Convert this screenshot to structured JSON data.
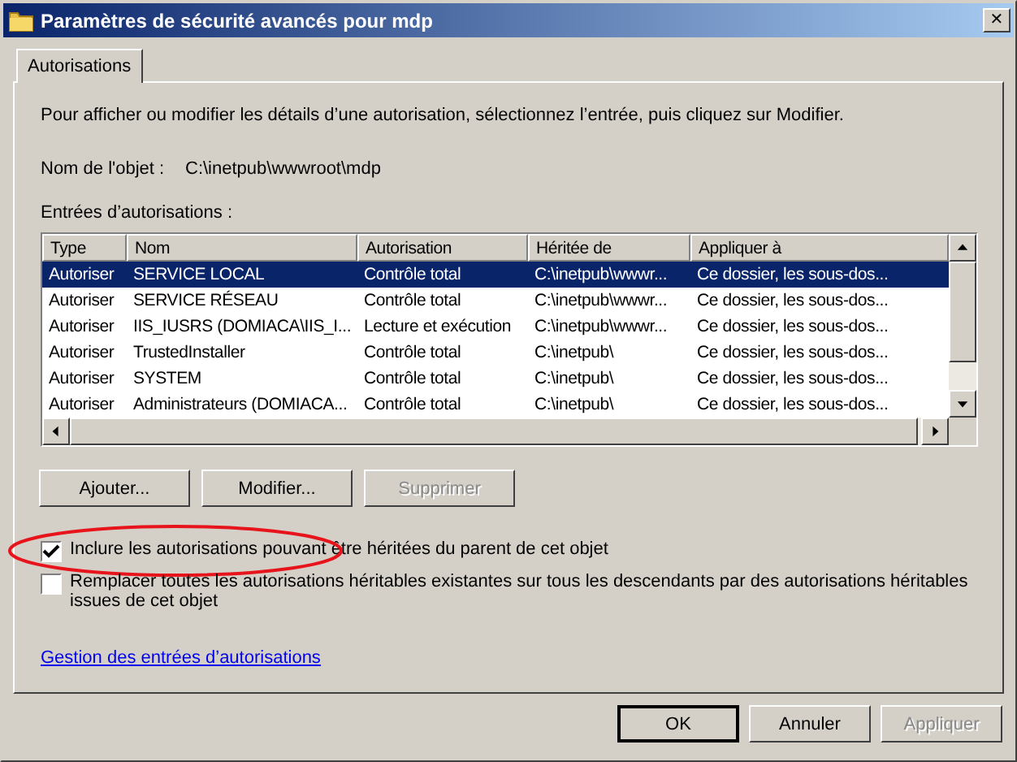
{
  "window": {
    "title": "Paramètres de sécurité avancés pour mdp",
    "close": "✕"
  },
  "tabs": [
    {
      "label": "Autorisations",
      "selected": true
    }
  ],
  "intro": "Pour afficher ou modifier les détails d’une autorisation, sélectionnez l’entrée, puis cliquez sur Modifier.",
  "object_name": {
    "label": "Nom de l'objet :",
    "value": "C:\\inetpub\\wwwroot\\mdp"
  },
  "entries_label": "Entrées d’autorisations :",
  "table": {
    "columns": [
      "Type",
      "Nom",
      "Autorisation",
      "Héritée de",
      "Appliquer à"
    ],
    "rows": [
      {
        "cells": [
          "Autoriser",
          "SERVICE LOCAL",
          "Contrôle total",
          "C:\\inetpub\\wwwr...",
          "Ce dossier, les sous-dos..."
        ],
        "selected": true
      },
      {
        "cells": [
          "Autoriser",
          "SERVICE RÉSEAU",
          "Contrôle total",
          "C:\\inetpub\\wwwr...",
          "Ce dossier, les sous-dos..."
        ],
        "selected": false
      },
      {
        "cells": [
          "Autoriser",
          "IIS_IUSRS (DOMIACA\\IIS_I...",
          "Lecture et exécution",
          "C:\\inetpub\\wwwr...",
          "Ce dossier, les sous-dos..."
        ],
        "selected": false
      },
      {
        "cells": [
          "Autoriser",
          "TrustedInstaller",
          "Contrôle total",
          "C:\\inetpub\\",
          "Ce dossier, les sous-dos..."
        ],
        "selected": false
      },
      {
        "cells": [
          "Autoriser",
          "SYSTEM",
          "Contrôle total",
          "C:\\inetpub\\",
          "Ce dossier, les sous-dos..."
        ],
        "selected": false
      },
      {
        "cells": [
          "Autoriser",
          "Administrateurs (DOMIACA...",
          "Contrôle total",
          "C:\\inetpub\\",
          "Ce dossier, les sous-dos..."
        ],
        "selected": false
      }
    ]
  },
  "entry_buttons": [
    {
      "label": "Ajouter...",
      "disabled": false
    },
    {
      "label": "Modifier...",
      "disabled": false
    },
    {
      "label": "Supprimer",
      "disabled": true
    }
  ],
  "checkboxes": [
    {
      "label": "Inclure les autorisations pouvant être héritées du parent de cet objet",
      "checked": true,
      "highlighted": true
    },
    {
      "label": "Remplacer toutes les autorisations héritables existantes sur tous les descendants par des autorisations héritables issues de cet objet",
      "checked": false,
      "highlighted": false
    }
  ],
  "link": "Gestion des entrées d’autorisations",
  "buttons": [
    {
      "label": "OK",
      "default": true,
      "disabled": false
    },
    {
      "label": "Annuler",
      "default": false,
      "disabled": false
    },
    {
      "label": "Appliquer",
      "default": false,
      "disabled": true
    }
  ]
}
